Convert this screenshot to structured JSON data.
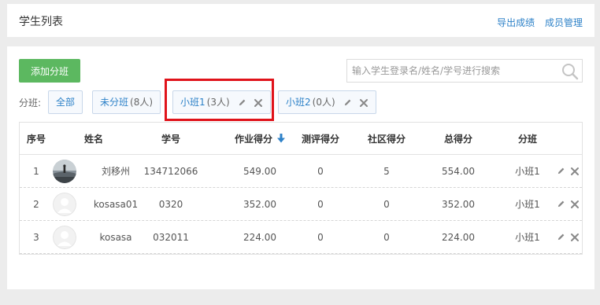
{
  "header": {
    "title": "学生列表",
    "export_link": "导出成绩",
    "members_link": "成员管理"
  },
  "toolbar": {
    "add_class_label": "添加分班",
    "search_placeholder": "输入学生登录名/姓名/学号进行搜索"
  },
  "groups": {
    "label": "分班:",
    "items": [
      {
        "name": "全部",
        "count": ""
      },
      {
        "name": "未分班",
        "count": "(8人)"
      },
      {
        "name": "小班1",
        "count": "(3人)"
      },
      {
        "name": "小班2",
        "count": "(0人)"
      }
    ]
  },
  "table": {
    "headers": [
      "序号",
      "姓名",
      "学号",
      "作业得分",
      "测评得分",
      "社区得分",
      "总得分",
      "分班"
    ],
    "rows": [
      {
        "no": "1",
        "name": "刘移州",
        "id": "134712066",
        "hw": "549.00",
        "test": "0",
        "comm": "5",
        "total": "554.00",
        "class": "小班1",
        "avatar": "photo"
      },
      {
        "no": "2",
        "name": "kosasa01",
        "id": "0320",
        "hw": "352.00",
        "test": "0",
        "comm": "0",
        "total": "352.00",
        "class": "小班1",
        "avatar": "default"
      },
      {
        "no": "3",
        "name": "kosasa",
        "id": "032011",
        "hw": "224.00",
        "test": "0",
        "comm": "0",
        "total": "224.00",
        "class": "小班1",
        "avatar": "default"
      }
    ]
  },
  "colors": {
    "link": "#2e82c8",
    "add_button": "#5cb860",
    "highlight_box": "#e0131a",
    "icon_gray": "#888888"
  },
  "icons": {
    "search": "search-icon",
    "sort": "arrow-down-icon",
    "edit": "pencil-icon",
    "delete": "close-icon"
  }
}
